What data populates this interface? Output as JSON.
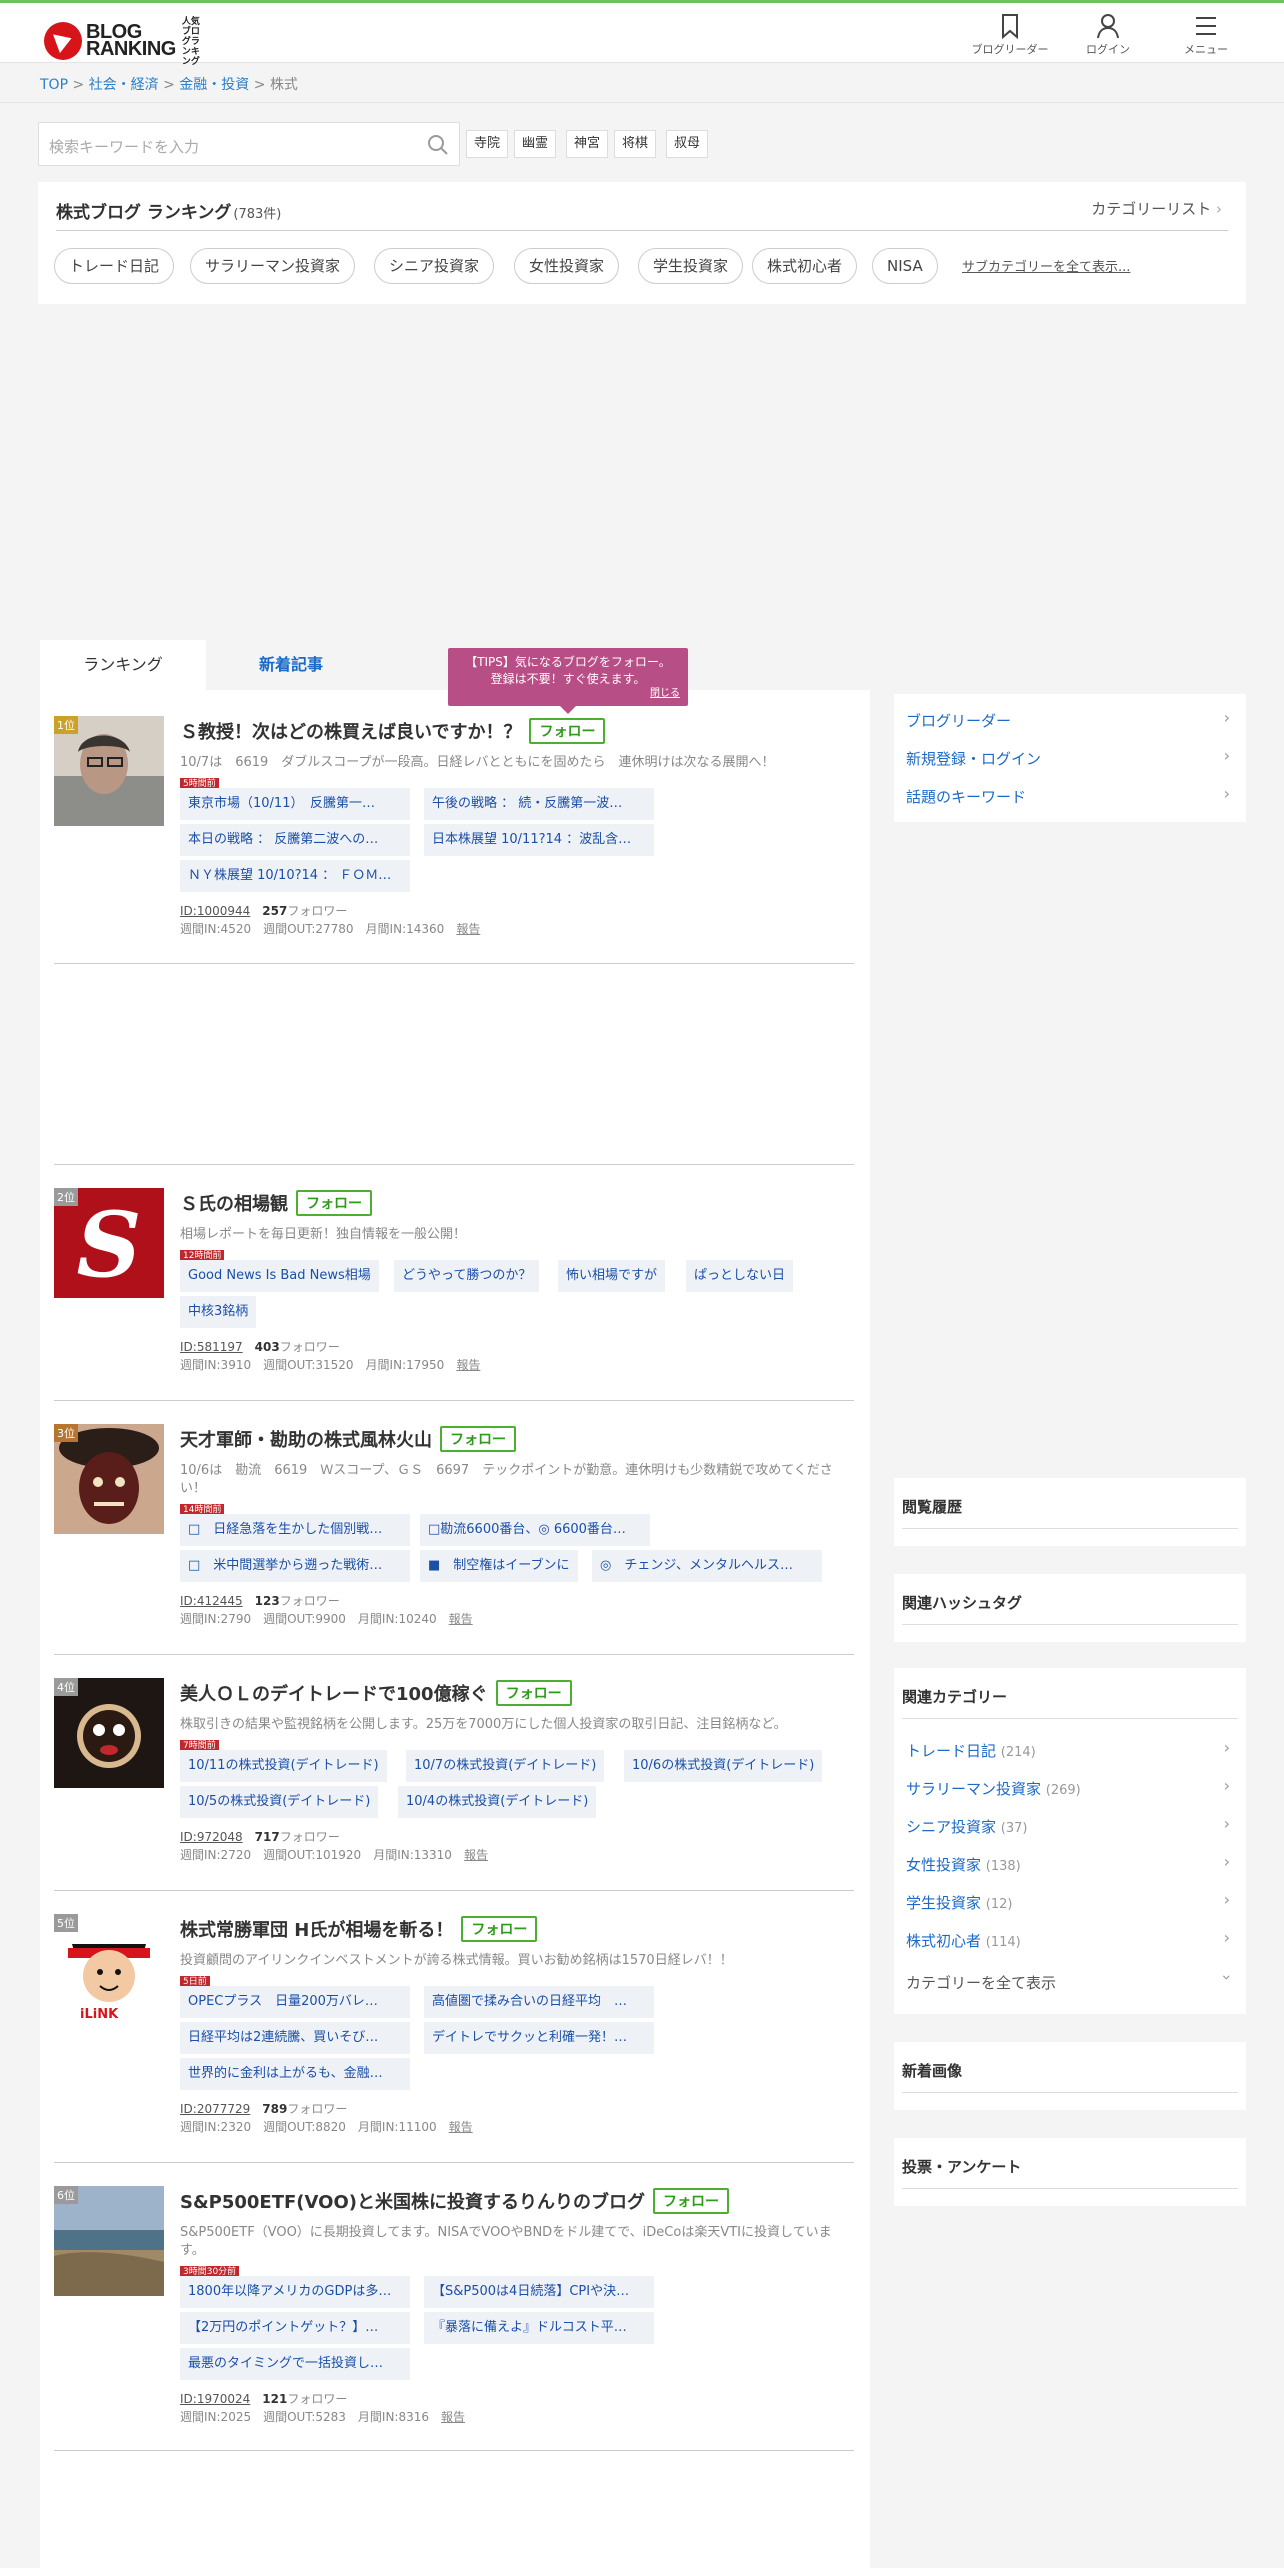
{
  "header": {
    "logo_text_1": "BLOG",
    "logo_text_2": "RANKING",
    "logo_sub": "人気ブログランキング",
    "nav": [
      {
        "label": "ブログリーダー",
        "icon": "bookmark-icon"
      },
      {
        "label": "ログイン",
        "icon": "user-icon"
      },
      {
        "label": "メニュー",
        "icon": "menu-icon"
      }
    ]
  },
  "breadcrumb": {
    "items": [
      "TOP",
      "社会・経済",
      "金融・投資"
    ],
    "current": "株式",
    "separator": ">"
  },
  "search": {
    "placeholder": "検索キーワードを入力",
    "keywords": [
      "寺院",
      "幽霊",
      "神宮",
      "将棋",
      "叔母"
    ]
  },
  "panel": {
    "title": "株式ブログ ランキング",
    "count": "(783件)",
    "category_list": "カテゴリーリスト",
    "chips": [
      "トレード日記",
      "サラリーマン投資家",
      "シニア投資家",
      "女性投資家",
      "学生投資家",
      "株式初心者",
      "NISA"
    ],
    "subcategories_link": "サブカテゴリーを全て表示..."
  },
  "tabs": {
    "ranking": "ランキング",
    "new_articles": "新着記事"
  },
  "tips": {
    "line1": "【TIPS】気になるブログをフォロー。",
    "line2": "登録は不要！すぐ使えます。",
    "close": "閉じる"
  },
  "follow_label": "フォロー",
  "follower_suffix": "フォロワー",
  "report_label": "報告",
  "entries": [
    {
      "rank": "1位",
      "title": "Ｓ教授！次はどの株買えば良いですか！？",
      "desc": "10/7は　6619　ダブルスコープが一段高。日経レバとともにを固めたら　連休明けは次なる展開へ！",
      "badge": "5時間前",
      "articles": [
        "東京市場（10/11）　反騰第一…",
        "午後の戦略 ： 続・反騰第一波…",
        "本日の戦略 ： 反騰第二波への…",
        "日本株展望 10/11?14 ：波乱含…",
        "ＮＹ株展望 10/10?14 ： ＦＯＭ…"
      ],
      "id": "ID:1000944",
      "followers": "257",
      "stats": "週間IN:4520　週間OUT:27780　月間IN:14360"
    },
    {
      "rank": "2位",
      "title": "Ｓ氏の相場観",
      "desc": "相場レポートを毎日更新！独自情報を一般公開！",
      "badge": "12時間前",
      "articles": [
        "Good News Is Bad News相場",
        "どうやって勝つのか？",
        "怖い相場ですが",
        "ぱっとしない日",
        "中核3銘柄"
      ],
      "id": "ID:581197",
      "followers": "403",
      "stats": "週間IN:3910　週間OUT:31520　月間IN:17950"
    },
    {
      "rank": "3位",
      "title": "天才軍師・勘助の株式風林火山",
      "desc": "10/6は　勘流　6619　Ｗスコープ、ＧＳ　6697　テックポイントが勤意。連休明けも少数精鋭で攻めてください！",
      "badge": "14時間前",
      "articles": [
        "□　日経急落を生かした個別戦…",
        "□勘流6600番台、◎ 6600番台…",
        "□　米中間選挙から遡った戦術…",
        "■　制空権はイーブンに",
        "◎　チェンジ、メンタルヘルス…"
      ],
      "id": "ID:412445",
      "followers": "123",
      "stats": "週間IN:2790　週間OUT:9900　月間IN:10240"
    },
    {
      "rank": "4位",
      "title": "美人ＯＬのデイトレードで100億稼ぐ",
      "desc": "株取引きの結果や監視銘柄を公開します。25万を7000万にした個人投資家の取引日記、注目銘柄など。",
      "badge": "7時間前",
      "articles": [
        "10/11の株式投資(デイトレード)",
        "10/7の株式投資(デイトレード)",
        "10/6の株式投資(デイトレード)",
        "10/5の株式投資(デイトレード)",
        "10/4の株式投資(デイトレード)"
      ],
      "id": "ID:972048",
      "followers": "717",
      "stats": "週間IN:2720　週間OUT:101920　月間IN:13310"
    },
    {
      "rank": "5位",
      "title": "株式常勝軍団 H氏が相場を斬る！",
      "desc": "投資顧問のアイリンクインベストメントが誇る株式情報。買いお勧め銘柄は1570日経レバ！！",
      "badge": "5日前",
      "articles": [
        "OPECプラス　日量200万バレ…",
        "高値圏で揉み合いの日経平均　…",
        "日経平均は2連続騰、買いそび…",
        "デイトレでサクッと利確一発！…",
        "世界的に金利は上がるも、金融…"
      ],
      "id": "ID:2077729",
      "followers": "789",
      "stats": "週間IN:2320　週間OUT:8820　月間IN:11100"
    },
    {
      "rank": "6位",
      "title": "S&P500ETF(VOO)と米国株に投資するりんりのブログ",
      "desc": "S&P500ETF（VOO）に長期投資してます。NISAでVOOやBNDをドル建てで、iDeCoは楽天VTIに投資しています。",
      "badge": "3時間30分前",
      "articles": [
        "1800年以降アメリカのGDPは多…",
        "【S&P500は4日続落】CPIや決…",
        "【2万円のポイントゲット？】…",
        "『暴落に備えよ』ドルコスト平…",
        "最悪のタイミングで一括投資し…"
      ],
      "id": "ID:1970024",
      "followers": "121",
      "stats": "週間IN:2025　週間OUT:5283　月間IN:8316"
    }
  ],
  "sidebar": {
    "links": [
      "ブログリーダー",
      "新規登録・ログイン",
      "話題のキーワード"
    ],
    "history_title": "閲覧履歴",
    "hashtag_title": "関連ハッシュタグ",
    "related_title": "関連カテゴリー",
    "related": [
      {
        "name": "トレード日記",
        "count": "(214)"
      },
      {
        "name": "サラリーマン投資家",
        "count": "(269)"
      },
      {
        "name": "シニア投資家",
        "count": "(37)"
      },
      {
        "name": "女性投資家",
        "count": "(138)"
      },
      {
        "name": "学生投資家",
        "count": "(12)"
      },
      {
        "name": "株式初心者",
        "count": "(114)"
      }
    ],
    "show_all": "カテゴリーを全て表示",
    "new_images_title": "新着画像",
    "vote_title": "投票・アンケート"
  }
}
